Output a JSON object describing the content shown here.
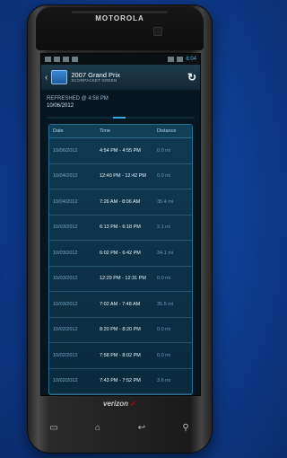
{
  "device": {
    "brand": "MOTOROLA",
    "carrier": "verizon",
    "carrier_mark": "✓"
  },
  "status_bar": {
    "time": "6:04",
    "left_icons": [
      "image-icon",
      "bag-icon",
      "settings-icon",
      "signal-icon"
    ],
    "right_icons": [
      "wifi-icon",
      "battery-icon"
    ]
  },
  "app_bar": {
    "title": "2007 Grand Prix",
    "subtitle": "SCORPACKET GREEN",
    "back_icon": "‹",
    "refresh_icon": "↻"
  },
  "refreshed": {
    "label": "REFRESHED @ 4:58 PM",
    "date": "10/06/2012"
  },
  "progress": {
    "fraction": 0.45
  },
  "table": {
    "headers": [
      "Date",
      "Time",
      "Distance"
    ],
    "rows": [
      {
        "date": "10/06/2012",
        "time": "4:54 PM - 4:55 PM",
        "distance": "0.0 mi"
      },
      {
        "date": "10/04/2012",
        "time": "12:40 PM - 12:42 PM",
        "distance": "0.0 mi"
      },
      {
        "date": "10/04/2012",
        "time": "7:26 AM - 8:06 AM",
        "distance": "35.4 mi"
      },
      {
        "date": "10/03/2012",
        "time": "6:13 PM - 6:18 PM",
        "distance": "2.1 mi"
      },
      {
        "date": "10/03/2012",
        "time": "6:02 PM - 6:42 PM",
        "distance": "34.1 mi"
      },
      {
        "date": "10/03/2012",
        "time": "12:29 PM - 12:31 PM",
        "distance": "0.0 mi"
      },
      {
        "date": "10/03/2012",
        "time": "7:02 AM - 7:48 AM",
        "distance": "35.5 mi"
      },
      {
        "date": "10/02/2012",
        "time": "8:20 PM - 8:20 PM",
        "distance": "0.0 mi"
      },
      {
        "date": "10/02/2012",
        "time": "7:58 PM - 8:02 PM",
        "distance": "0.0 mi"
      },
      {
        "date": "10/02/2012",
        "time": "7:43 PM - 7:52 PM",
        "distance": "3.6 mi"
      }
    ]
  },
  "nav": {
    "icons": [
      "menu-icon",
      "home-icon",
      "back-icon",
      "search-icon"
    ],
    "glyphs": [
      "▭",
      "⌂",
      "↩",
      "⚲"
    ]
  },
  "colors": {
    "background": "#1b56b7",
    "accent": "#3aa6df",
    "table_bg": "#0f3a52"
  }
}
